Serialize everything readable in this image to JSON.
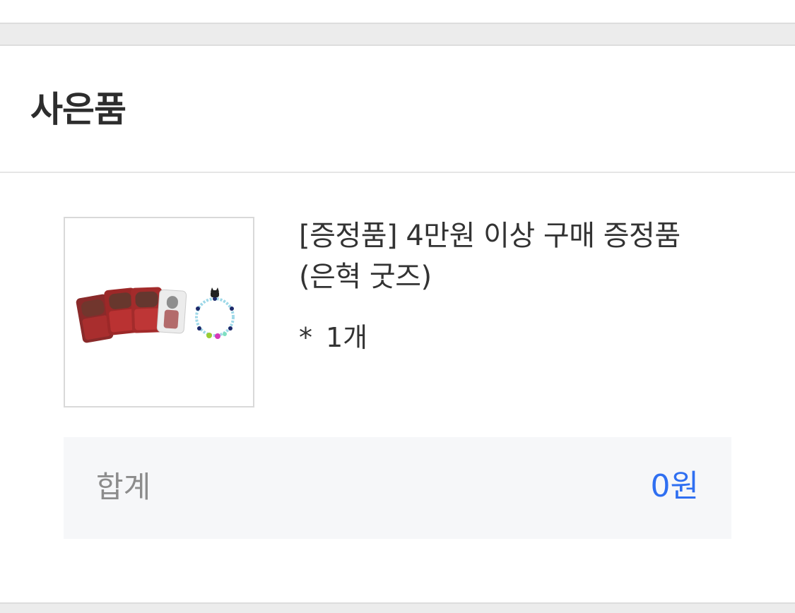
{
  "gift_section": {
    "title": "사은품",
    "item": {
      "name": "[증정품] 4만원 이상 구매 증정품 (은혁 굿즈)",
      "quantity_marker": "*",
      "quantity": "1개",
      "thumbnail_icon": "gift-goods-photo"
    },
    "total": {
      "label": "합계",
      "value": "0원"
    }
  },
  "colors": {
    "accent": "#2f6ff1",
    "band": "#ececec",
    "total_bg": "#f6f7f9"
  }
}
